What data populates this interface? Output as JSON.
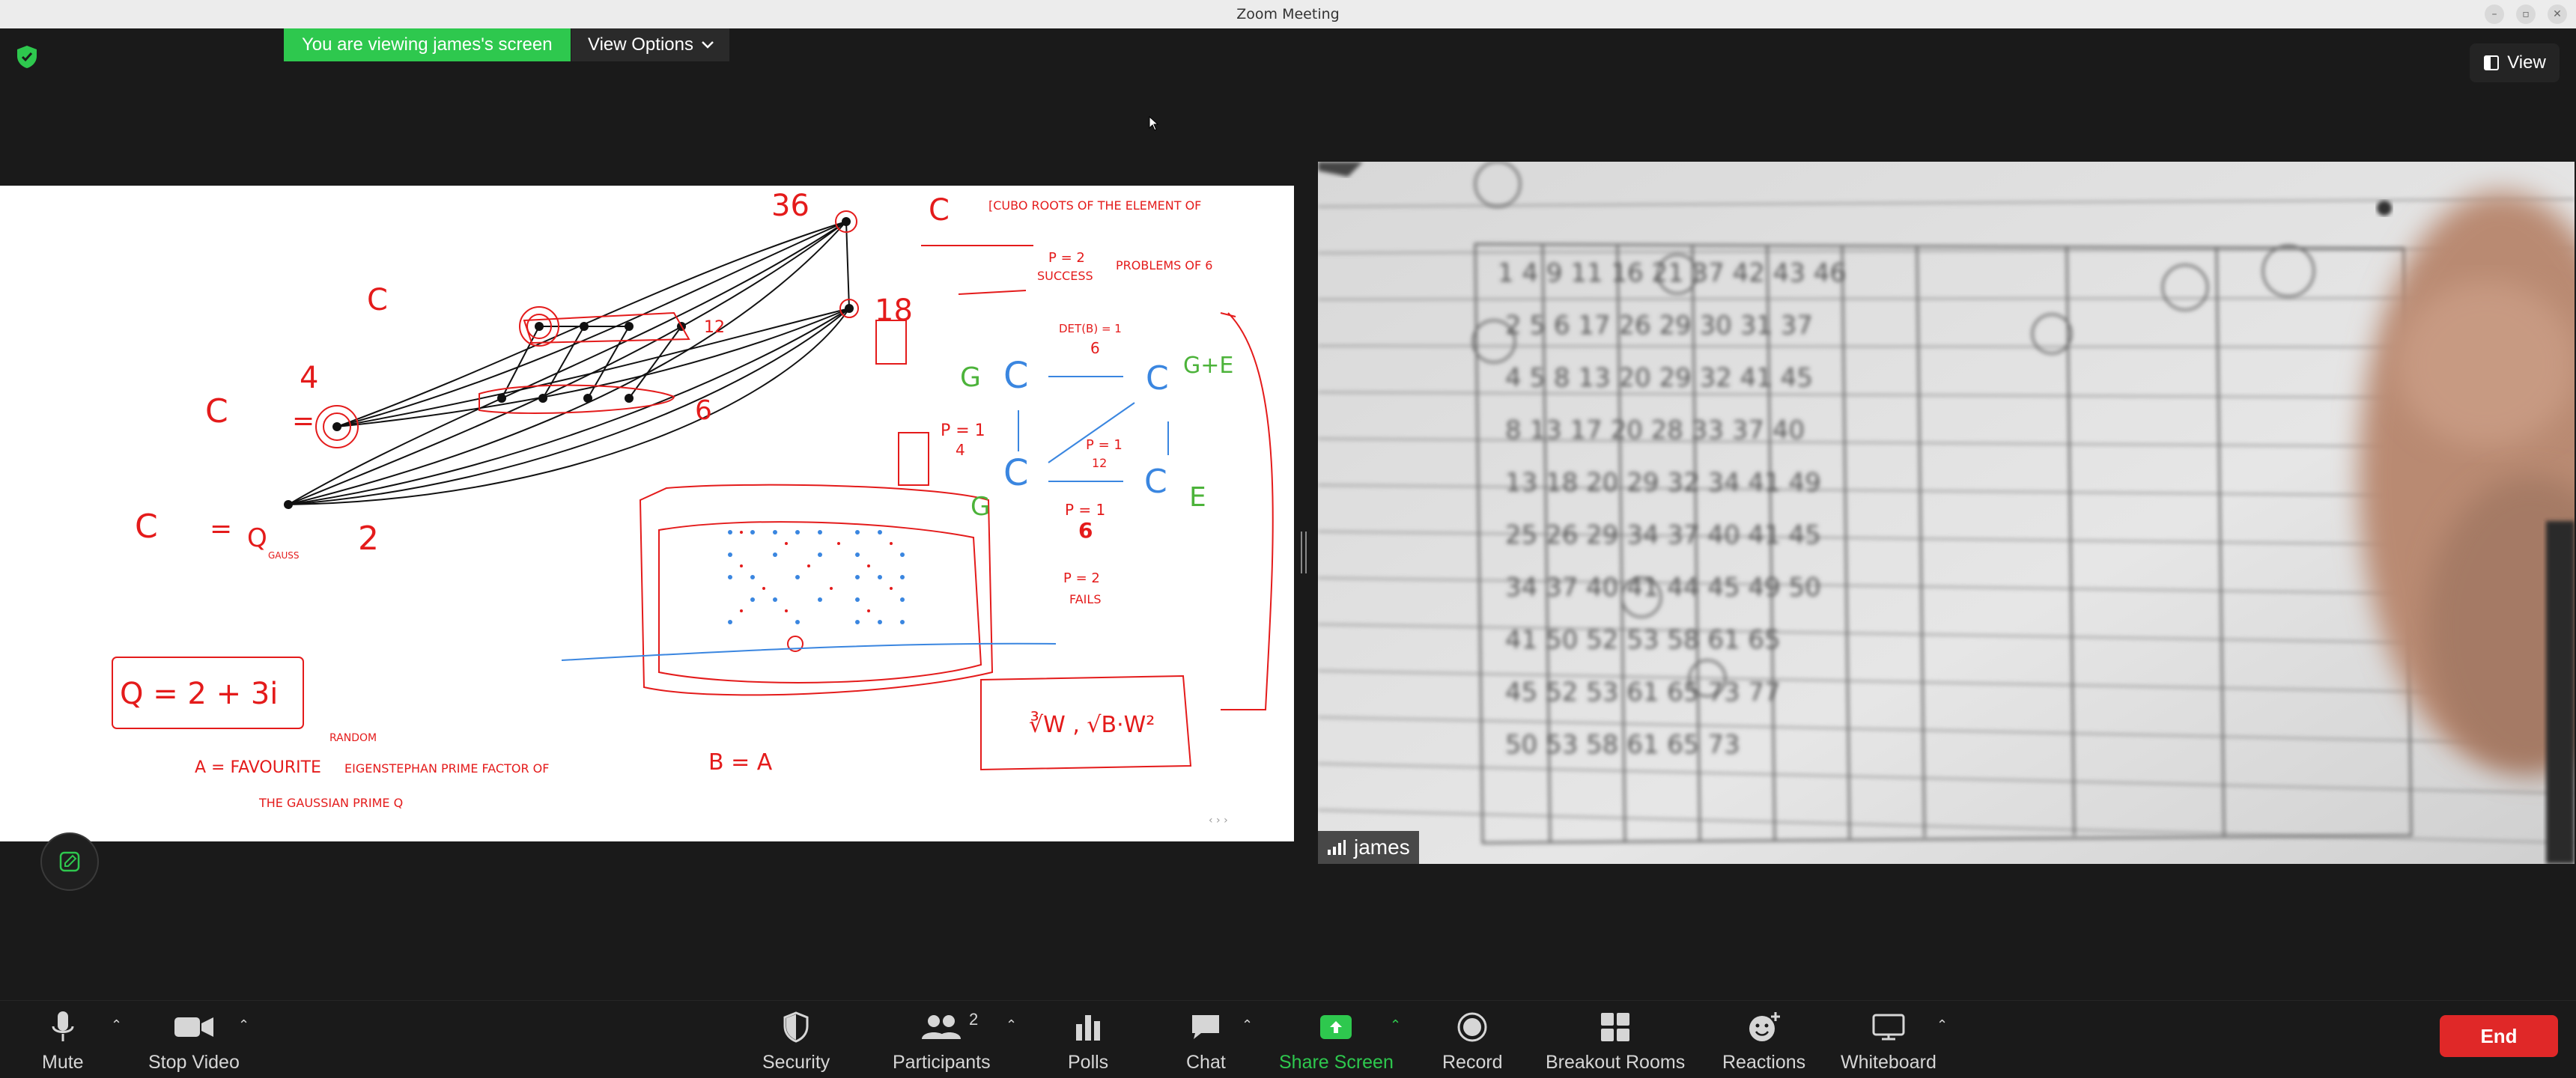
{
  "window": {
    "title": "Zoom Meeting",
    "controls": [
      "–",
      "▫",
      "✕"
    ]
  },
  "banner": {
    "text": "You are viewing james's screen",
    "view_options": "View Options"
  },
  "view_button": {
    "label": "View"
  },
  "participant": {
    "name": "james"
  },
  "whiteboard": {
    "c36_label": "C",
    "n36": "36",
    "n18": "18",
    "n4": "4",
    "n6": "6",
    "n2": "2",
    "n12": "12",
    "c12_note": "[CUBO ROOTS OF THE ELEMENT OF",
    "p2_success": "P = 2",
    "success_word": "SUCCESS",
    "proof_note": "PROBLEMS OF 6",
    "det_box": "DET(B) = 1",
    "det_six": "6",
    "g_label": "G",
    "e_label": "E",
    "ge_label": "G+E",
    "p1_4": "P = 1",
    "p1_4_den": "4",
    "p1_12": "P = 1",
    "p1_12_den": "12",
    "p1_6": "P = 1",
    "p1_6_den": "6",
    "p2_fails": "P = 2",
    "fails_word": "FAILS",
    "q_box": "Q = 2 + 3i",
    "a_line1": "A = FAVOURITE ",
    "a_line1b": "EIGENSTEPHAN PRIME FACTOR OF",
    "a_line2": "THE GAUSSIAN PRIME Q",
    "a_small": "RANDOM",
    "b_eq": "B = A",
    "root_box": "∛W , √B·W²",
    "c4_eq": "C",
    "q_gauss": "Q",
    "gauss_sub": "GAUSS"
  },
  "toolbar": {
    "mute": "Mute",
    "stop_video": "Stop Video",
    "security": "Security",
    "participants": "Participants",
    "participants_count": "2",
    "polls": "Polls",
    "chat": "Chat",
    "share_screen": "Share Screen",
    "record": "Record",
    "breakout_rooms": "Breakout Rooms",
    "reactions": "Reactions",
    "whiteboard": "Whiteboard",
    "end": "End"
  },
  "colors": {
    "share_green": "#2ec84e",
    "end_red": "#e02828",
    "ink_red": "#e41b1b",
    "ink_blue": "#3a86e0",
    "ink_green": "#4cb33a"
  }
}
